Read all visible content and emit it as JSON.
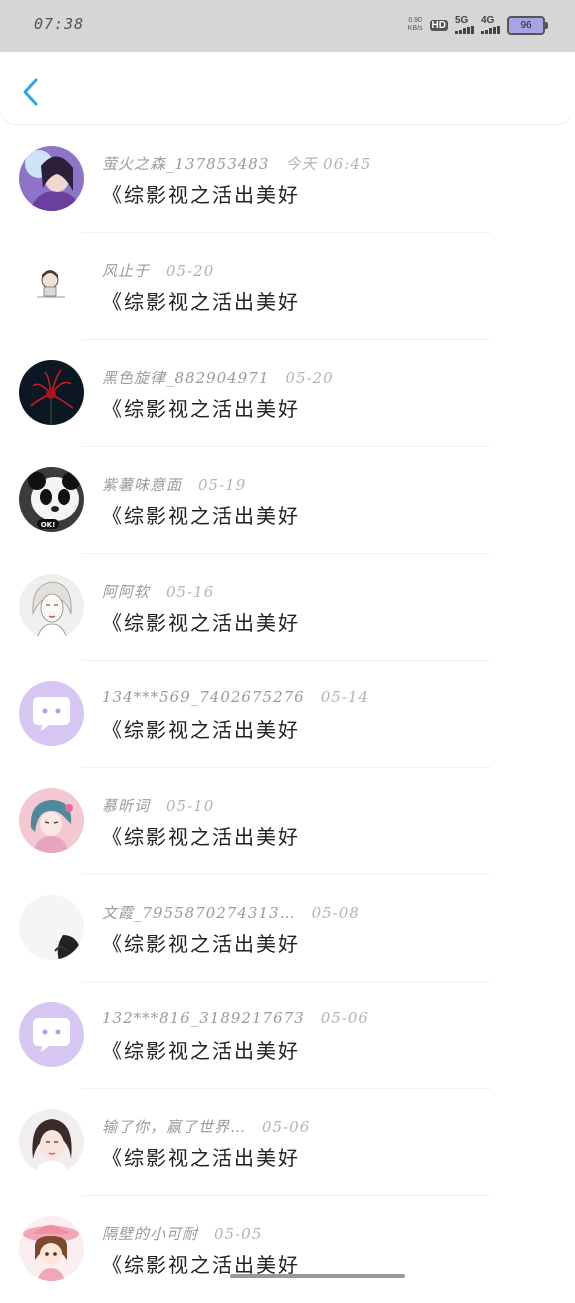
{
  "status_bar": {
    "time": "07:38",
    "net_speed_value": "0.90",
    "net_speed_unit": "KB/s",
    "hd": "HD",
    "sim1": "5G",
    "sim2": "4G",
    "battery": "96"
  },
  "header": {
    "back_icon": "chevron-left-icon"
  },
  "comments": [
    {
      "user": "萤火之森_137853483",
      "date": "今天 06:45",
      "text": "《综影视之活出美好",
      "avatar": "photo-girl-purple"
    },
    {
      "user": "风止于",
      "date": "05-20",
      "text": "《综影视之活出美好",
      "avatar": "cartoon-small"
    },
    {
      "user": "黑色旋律_882904971",
      "date": "05-20",
      "text": "《综影视之活出美好",
      "avatar": "red-flower-dark"
    },
    {
      "user": "紫薯味意面",
      "date": "05-19",
      "text": "《综影视之活出美好",
      "avatar": "panda"
    },
    {
      "user": "阿阿软",
      "date": "05-16",
      "text": "《综影视之活出美好",
      "avatar": "sketch-girl"
    },
    {
      "user": "134***569_7402675276",
      "date": "05-14",
      "text": "《综影视之活出美好",
      "avatar": "default-chat"
    },
    {
      "user": "慕昕词",
      "date": "05-10",
      "text": "《综影视之活出美好",
      "avatar": "anime-girl-pink"
    },
    {
      "user": "文霞_7955870274313…",
      "date": "05-08",
      "text": "《综影视之活出美好",
      "avatar": "bw-silhouette"
    },
    {
      "user": "132***816_3189217673",
      "date": "05-06",
      "text": "《综影视之活出美好",
      "avatar": "default-chat"
    },
    {
      "user": "输了你，赢了世界…",
      "date": "05-06",
      "text": "《综影视之活出美好",
      "avatar": "photo-girl"
    },
    {
      "user": "隔壁的小可耐",
      "date": "05-05",
      "text": "《综影视之活出美好",
      "avatar": "cartoon-girl-hat"
    }
  ],
  "colors": {
    "accent": "#2aa7e0",
    "default_avatar_bg": "#d5c6f2",
    "default_avatar_fg": "#b89ee8",
    "status_bar_bg": "#d6d6d6"
  }
}
